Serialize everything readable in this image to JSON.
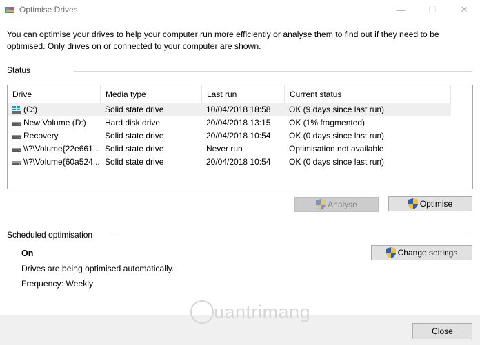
{
  "window": {
    "title": "Optimise Drives",
    "minimize": "—",
    "maximize": "☐",
    "close": "✕"
  },
  "intro_text": "You can optimise your drives to help your computer run more efficiently or analyse them to find out if they need to be optimised. Only drives on or connected to your computer are shown.",
  "status_section": {
    "label": "Status",
    "columns": [
      "Drive",
      "Media type",
      "Last run",
      "Current status"
    ],
    "rows": [
      {
        "drive": "(C:)",
        "icon": "windows-drive-icon",
        "media": "Solid state drive",
        "last_run": "10/04/2018 18:58",
        "status": "OK (9 days since last run)"
      },
      {
        "drive": "New Volume (D:)",
        "icon": "hard-drive-icon",
        "media": "Hard disk drive",
        "last_run": "20/04/2018 13:15",
        "status": "OK (1% fragmented)"
      },
      {
        "drive": "Recovery",
        "icon": "hard-drive-icon",
        "media": "Solid state drive",
        "last_run": "20/04/2018 10:54",
        "status": "OK (0 days since last run)"
      },
      {
        "drive": "\\\\?\\Volume{22e661...",
        "icon": "hard-drive-icon",
        "media": "Solid state drive",
        "last_run": "Never run",
        "status": "Optimisation not available"
      },
      {
        "drive": "\\\\?\\Volume{60a524...",
        "icon": "hard-drive-icon",
        "media": "Solid state drive",
        "last_run": "20/04/2018 10:54",
        "status": "OK (0 days since last run)"
      }
    ],
    "analyse_label": "Analyse",
    "optimise_label": "Optimise"
  },
  "schedule_section": {
    "label": "Scheduled optimisation",
    "state": "On",
    "description": "Drives are being optimised automatically.",
    "frequency": "Frequency: Weekly",
    "change_label": "Change settings"
  },
  "footer": {
    "close_label": "Close"
  },
  "watermark": "uantrimang"
}
